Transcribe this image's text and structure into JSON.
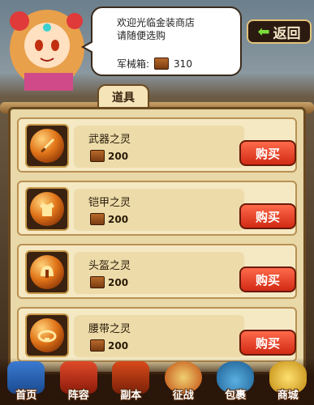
{
  "header": {
    "greeting": "欢迎光临金装商店\n请随便选购",
    "box_label": "军械箱:",
    "box_count": "310",
    "back_label": "返回",
    "back_icon": "arrow-left-icon"
  },
  "tab": {
    "label": "道具"
  },
  "items": [
    {
      "name": "武器之灵",
      "price": "200",
      "buy_label": "购买",
      "icon": "sword-icon"
    },
    {
      "name": "铠甲之灵",
      "price": "200",
      "buy_label": "购买",
      "icon": "armor-icon"
    },
    {
      "name": "头盔之灵",
      "price": "200",
      "buy_label": "购买",
      "icon": "helmet-icon"
    },
    {
      "name": "腰带之灵",
      "price": "200",
      "buy_label": "购买",
      "icon": "belt-icon"
    }
  ],
  "nav": [
    {
      "label": "首页",
      "icon": "home-icon"
    },
    {
      "label": "阵容",
      "icon": "formation-icon"
    },
    {
      "label": "副本",
      "icon": "dungeon-icon"
    },
    {
      "label": "征战",
      "icon": "battle-icon"
    },
    {
      "label": "包裹",
      "icon": "bag-icon"
    },
    {
      "label": "商城",
      "icon": "shop-icon"
    }
  ],
  "colors": {
    "buy_button": "#e0341a",
    "accent_green": "#7cdc3a",
    "parchment": "#e9d8a8"
  }
}
